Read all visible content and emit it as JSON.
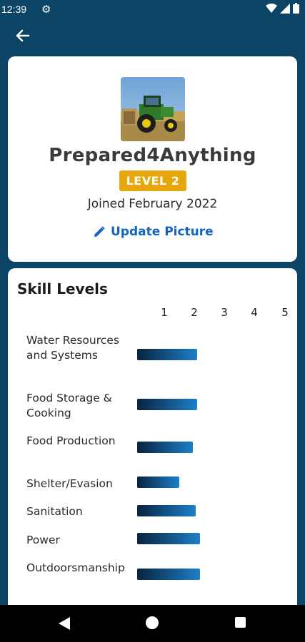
{
  "status": {
    "time": "12:39"
  },
  "profile": {
    "username": "Prepared4Anything",
    "level": "LEVEL 2",
    "joined": "Joined February 2022",
    "update_picture": "Update Picture"
  },
  "skills": {
    "title": "Skill Levels",
    "scale": [
      "1",
      "2",
      "3",
      "4",
      "5"
    ],
    "items": [
      {
        "label": "Water Resources and Systems",
        "value": 2.1
      },
      {
        "label": "Food Storage & Cooking",
        "value": 2.1
      },
      {
        "label": "Food Production",
        "value": 1.95
      },
      {
        "label": "Shelter/Evasion",
        "value": 1.5
      },
      {
        "label": "Sanitation",
        "value": 2.05
      },
      {
        "label": "Power",
        "value": 2.2
      },
      {
        "label": "Outdoorsmanship",
        "value": 2.2
      }
    ]
  },
  "colors": {
    "primary": "#0c4466",
    "accent": "#e8a60d",
    "link": "#1565c0"
  },
  "icons": {
    "back": "arrow-left-icon",
    "edit": "pencil-icon",
    "settings": "gear-icon",
    "wifi": "wifi-icon",
    "signal": "signal-icon",
    "battery": "battery-icon"
  }
}
